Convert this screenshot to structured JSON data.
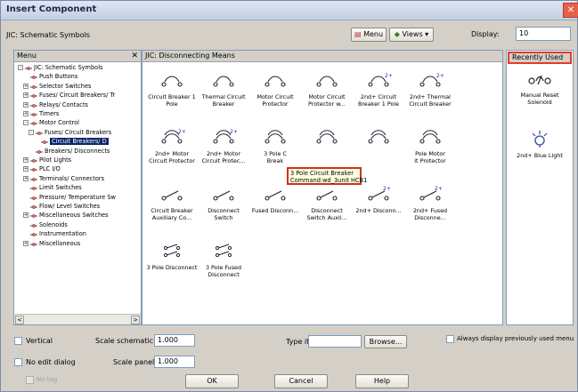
{
  "window": {
    "title": "Insert Component",
    "close_glyph": "✕"
  },
  "header": {
    "library": "JIC: Schematic Symbols",
    "menu_label": "Menu",
    "views_label": "Views ▾",
    "display_label": "Display:",
    "display_value": "10"
  },
  "tree": {
    "title": "Menu",
    "close_glyph": "✕",
    "items": [
      {
        "label": "JIC: Schematic Symbols",
        "expander": "-"
      },
      {
        "label": "Push Buttons",
        "expander": ""
      },
      {
        "label": "Selector Switches",
        "expander": "+"
      },
      {
        "label": "Fuses/ Circuit Breakers/ Tr",
        "expander": "+"
      },
      {
        "label": "Relays/ Contacts",
        "expander": "+"
      },
      {
        "label": "Timers",
        "expander": "+"
      },
      {
        "label": "Motor Control",
        "expander": "-"
      },
      {
        "label": "Fuses/ Circuit Breakers",
        "expander": "-"
      },
      {
        "label": "Circuit Breakers/ D",
        "expander": ""
      },
      {
        "label": "Breakers/ Disconnects",
        "expander": ""
      },
      {
        "label": "Pilot Lights",
        "expander": "+"
      },
      {
        "label": "PLC I/O",
        "expander": "+"
      },
      {
        "label": "Terminals/ Connectors",
        "expander": "+"
      },
      {
        "label": "Limit Switches",
        "expander": ""
      },
      {
        "label": "Pressure/ Temperature Sw",
        "expander": ""
      },
      {
        "label": "Flow/ Level Switches",
        "expander": ""
      },
      {
        "label": "Miscellaneous Switches",
        "expander": "+"
      },
      {
        "label": "Solenoids",
        "expander": ""
      },
      {
        "label": "Instrumentation",
        "expander": ""
      },
      {
        "label": "Miscellaneous",
        "expander": "+"
      }
    ],
    "scroll_left": "<",
    "scroll_right": ">"
  },
  "grid": {
    "title": "JIC: Disconnecting Means",
    "items": [
      {
        "label": "Circuit Breaker 1 Pole",
        "icon": "breaker-1pole-icon"
      },
      {
        "label": "Thermal Circuit Breaker",
        "icon": "thermal-breaker-icon"
      },
      {
        "label": "Motor Circuit Protector",
        "icon": "motor-protector-icon"
      },
      {
        "label": "Motor Circuit Protector w...",
        "icon": "motor-protector-w-icon"
      },
      {
        "label": "2nd+ Circuit Breaker 1 Pole",
        "icon": "breaker-2nd-icon"
      },
      {
        "label": "2nd+ Thermal Circuit Breaker",
        "icon": "thermal-2nd-icon"
      },
      {
        "label": "2nd+ Motor Circuit Protector",
        "icon": "motor-2nd-icon"
      },
      {
        "label": "2nd+ Motor Circuit Protec...",
        "icon": "motor-2nd-protec-icon"
      },
      {
        "label": "3 Pole Circuit Breaker",
        "icon": "breaker-3pole-icon"
      },
      {
        "label": "",
        "icon": "thermal-3pole-icon"
      },
      {
        "label": "",
        "icon": "motor-3pole-icon"
      },
      {
        "label": "3 Pole Motor Circuit Protec...",
        "icon": "motor-3pole-protec-icon"
      },
      {
        "label": "Circuit Breaker Auxiliary Co...",
        "icon": "breaker-aux-icon"
      },
      {
        "label": "Disconnect Switch",
        "icon": "disconnect-switch-icon"
      },
      {
        "label": "Fused Disconn...",
        "icon": "fused-disconnect-icon"
      },
      {
        "label": "Disconnect Switch Auxil...",
        "icon": "disconnect-aux-icon"
      },
      {
        "label": "2nd+ Disconn...",
        "icon": "disconnect-2nd-icon"
      },
      {
        "label": "2nd+ Fused Disconne...",
        "icon": "fused-2nd-icon"
      },
      {
        "label": "3 Pole Disconnect",
        "icon": "disconnect-3pole-icon"
      },
      {
        "label": "3 Pole Fused Disconnect",
        "icon": "fused-3pole-icon"
      }
    ],
    "tooltip_line1": "3 Pole Circuit Breaker",
    "tooltip_line2": "Command:wd_3unit HCB1",
    "label_3pole_partial": "3 Pole C",
    "label_3pole_tail": "Break",
    "label_motor_partial": "Pole Motor",
    "label_motor_tail": "it Protector"
  },
  "recent": {
    "title": "Recently Used",
    "items": [
      {
        "label": "Manual Reset Solenoid",
        "icon": "manual-reset-solenoid-icon"
      },
      {
        "label": "2nd+ Blue Light",
        "icon": "blue-light-icon"
      }
    ]
  },
  "footer": {
    "vertical_label": "Vertical",
    "no_edit_label": "No edit dialog",
    "no_tag_label": "No tag",
    "scale_schematic_label": "Scale schematic:",
    "scale_schematic_value": "1.000",
    "scale_panel_label": "Scale panel:",
    "scale_panel_value": "1.000",
    "type_it_label": "Type it",
    "browse_label": "Browse...",
    "always_display_label": "Always display previously used menu",
    "ok_label": "OK",
    "cancel_label": "Cancel",
    "help_label": "Help"
  },
  "colors": {
    "accent_red": "#e53a2a",
    "selection": "#0a246a",
    "tooltip_bg": "#ffffe1"
  }
}
